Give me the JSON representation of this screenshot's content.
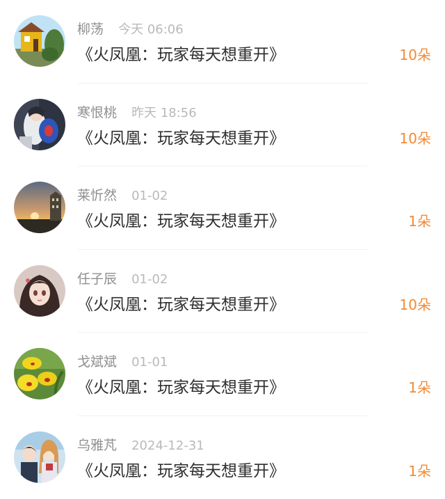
{
  "gift_list": {
    "items": [
      {
        "name": "柳荡",
        "time": "今天 06:06",
        "book": "《火凤凰：玩家每天想重开》",
        "count": "10朵",
        "avatar_icon": "yellow-house-photo-icon"
      },
      {
        "name": "寒恨桃",
        "time": "昨天 18:56",
        "book": "《火凤凰：玩家每天想重开》",
        "count": "10朵",
        "avatar_icon": "anime-character-photo-icon"
      },
      {
        "name": "莱忻然",
        "time": "01-02",
        "book": "《火凤凰：玩家每天想重开》",
        "count": "1朵",
        "avatar_icon": "sunset-photo-icon"
      },
      {
        "name": "任子辰",
        "time": "01-02",
        "book": "《火凤凰：玩家每天想重开》",
        "count": "10朵",
        "avatar_icon": "anime-girl-photo-icon"
      },
      {
        "name": "戈斌斌",
        "time": "01-01",
        "book": "《火凤凰：玩家每天想重开》",
        "count": "1朵",
        "avatar_icon": "yellow-orchid-photo-icon"
      },
      {
        "name": "乌雅芃",
        "time": "2024-12-31",
        "book": "《火凤凰：玩家每天想重开》",
        "count": "1朵",
        "avatar_icon": "anime-couple-photo-icon"
      }
    ]
  },
  "colors": {
    "count_accent": "#f28a35",
    "name_gray": "#8f8f8f",
    "time_gray": "#b9b9b9",
    "title_text": "#2e2e2e"
  }
}
